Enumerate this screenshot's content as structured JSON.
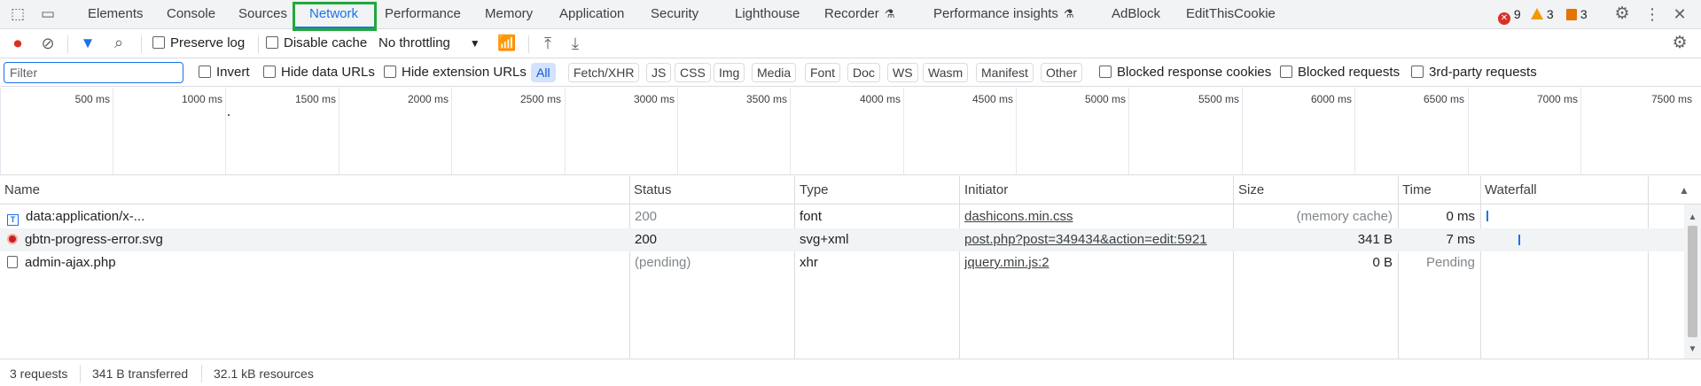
{
  "tabs": [
    {
      "label": "Elements"
    },
    {
      "label": "Console"
    },
    {
      "label": "Sources"
    },
    {
      "label": "Network"
    },
    {
      "label": "Performance"
    },
    {
      "label": "Memory"
    },
    {
      "label": "Application"
    },
    {
      "label": "Security"
    },
    {
      "label": "Lighthouse"
    },
    {
      "label": "Recorder"
    },
    {
      "label": "Performance insights"
    },
    {
      "label": "AdBlock"
    },
    {
      "label": "EditThisCookie"
    }
  ],
  "counters": {
    "errors": "9",
    "warnings": "3",
    "issues": "3"
  },
  "toolbar": {
    "preserve_log": "Preserve log",
    "disable_cache": "Disable cache",
    "throttling": "No throttling"
  },
  "filter": {
    "placeholder": "Filter",
    "invert": "Invert",
    "hide_data_urls": "Hide data URLs",
    "hide_extension_urls": "Hide extension URLs",
    "chips": [
      "All",
      "Fetch/XHR",
      "JS",
      "CSS",
      "Img",
      "Media",
      "Font",
      "Doc",
      "WS",
      "Wasm",
      "Manifest",
      "Other"
    ],
    "blocked_cookies": "Blocked response cookies",
    "blocked_requests": "Blocked requests",
    "third_party": "3rd-party requests"
  },
  "overview": {
    "ticks": [
      "500 ms",
      "1000 ms",
      "1500 ms",
      "2000 ms",
      "2500 ms",
      "3000 ms",
      "3500 ms",
      "4000 ms",
      "4500 ms",
      "5000 ms",
      "5500 ms",
      "6000 ms",
      "6500 ms",
      "7000 ms",
      "7500 ms"
    ]
  },
  "table": {
    "headers": {
      "name": "Name",
      "status": "Status",
      "type": "Type",
      "initiator": "Initiator",
      "size": "Size",
      "time": "Time",
      "waterfall": "Waterfall"
    },
    "rows": [
      {
        "name": "data:application/x-...",
        "status": "200",
        "type": "font",
        "initiator": "dashicons.min.css",
        "size": "(memory cache)",
        "time": "0 ms"
      },
      {
        "name": "gbtn-progress-error.svg",
        "status": "200",
        "type": "svg+xml",
        "initiator": "post.php?post=349434&action=edit:5921",
        "size": "341 B",
        "time": "7 ms"
      },
      {
        "name": "admin-ajax.php",
        "status": "(pending)",
        "type": "xhr",
        "initiator": "jquery.min.js:2",
        "size": "0 B",
        "time": "Pending"
      }
    ]
  },
  "status": {
    "requests": "3 requests",
    "transferred": "341 B transferred",
    "resources": "32.1 kB resources"
  }
}
